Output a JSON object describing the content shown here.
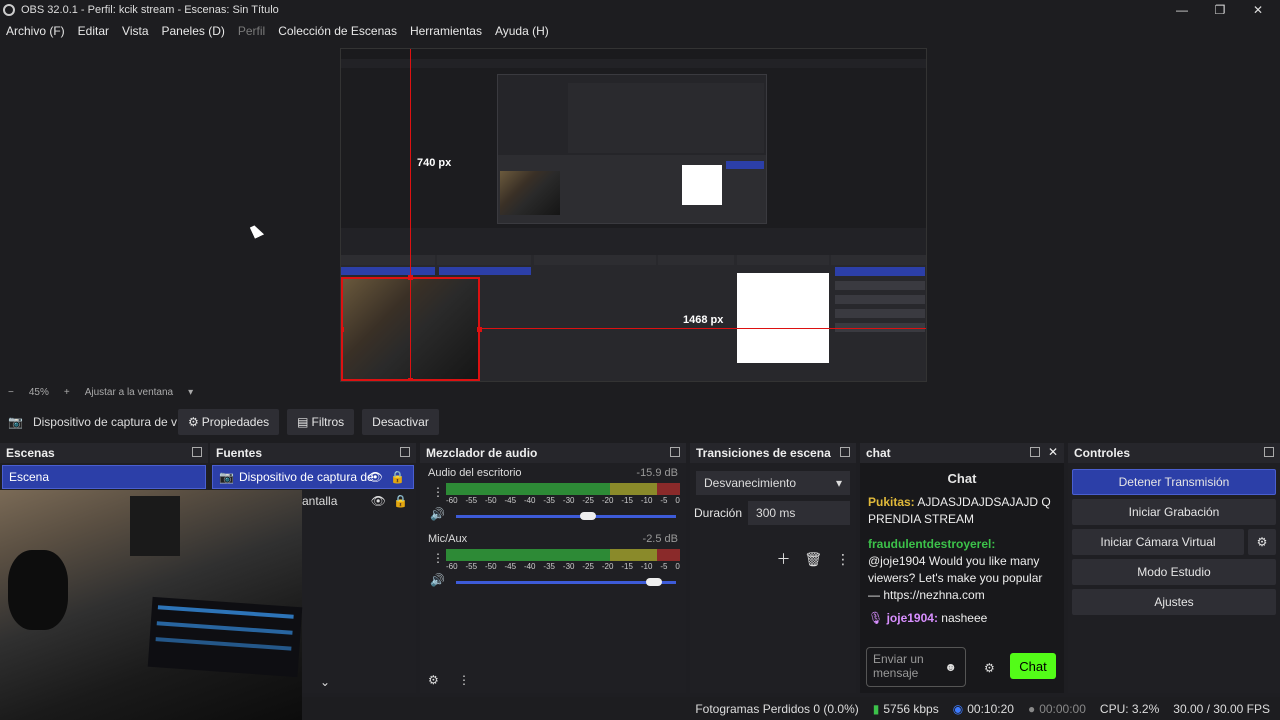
{
  "window": {
    "title": "OBS 32.0.1 - Perfil: kcik stream - Escenas: Sin Título",
    "minimize": "—",
    "maximize": "❐",
    "close": "✕"
  },
  "menu": [
    {
      "label": "Archivo (F)",
      "enabled": true
    },
    {
      "label": "Editar",
      "enabled": true
    },
    {
      "label": "Vista",
      "enabled": true
    },
    {
      "label": "Paneles (D)",
      "enabled": true
    },
    {
      "label": "Perfil",
      "enabled": false
    },
    {
      "label": "Colección de Escenas",
      "enabled": true
    },
    {
      "label": "Herramientas",
      "enabled": true
    },
    {
      "label": "Ayuda (H)",
      "enabled": true
    }
  ],
  "preview": {
    "label_vertical": "740 px",
    "label_horizontal": "1468 px"
  },
  "zoom": {
    "minus": "−",
    "value": "45%",
    "plus": "+",
    "fit": "Ajustar a la ventana"
  },
  "source_toolbar": {
    "source_name": "Dispositivo de captura de v",
    "properties": "Propiedades",
    "filters": "Filtros",
    "deactivate": "Desactivar"
  },
  "scenes": {
    "title": "Escenas",
    "items": [
      "Escena"
    ]
  },
  "sources": {
    "title": "Fuentes",
    "items": [
      "Dispositivo de captura de",
      "antalla"
    ]
  },
  "mixer": {
    "title": "Mezclador de audio",
    "scale": [
      "-60",
      "-55",
      "-50",
      "-45",
      "-40",
      "-35",
      "-30",
      "-25",
      "-20",
      "-15",
      "-10",
      "-5",
      "0"
    ],
    "channels": [
      {
        "name": "Audio del escritorio",
        "db": "-15.9 dB",
        "volume": 0.6
      },
      {
        "name": "Mic/Aux",
        "db": "-2.5 dB",
        "volume": 0.9
      }
    ]
  },
  "transitions": {
    "title": "Transiciones de escena",
    "selected": "Desvanecimiento",
    "duration_label": "Duración",
    "duration_value": "300 ms"
  },
  "chat": {
    "title": "chat",
    "header": "Chat",
    "messages": [
      {
        "user": "Pukitas:",
        "text": " AJDASJDAJDSAJAJD Q PRENDIA STREAM",
        "color": "#e0b93a"
      },
      {
        "user": "fraudulentdestroyerel:",
        "text": " @joje1904 Would you like many viewers? Let's make you popular — https://nezhna.com",
        "color": "#3cc24a"
      },
      {
        "user": "joje1904:",
        "text": " nasheee",
        "color": "#d88fff"
      }
    ],
    "input_placeholder": "Enviar un mensaje",
    "send": "Chat"
  },
  "controls": {
    "title": "Controles",
    "stop_stream": "Detener Transmisión",
    "start_recording": "Iniciar Grabación",
    "start_virtual_cam": "Iniciar Cámara Virtual",
    "studio_mode": "Modo Estudio",
    "settings": "Ajustes"
  },
  "status": {
    "dropped_frames": "Fotogramas Perdidos 0 (0.0%)",
    "bitrate": "5756 kbps",
    "stream_time": "00:10:20",
    "record_time": "00:00:00",
    "cpu": "CPU: 3.2%",
    "fps": "30.00 / 30.00 FPS"
  },
  "colors": {
    "accent": "#2c3fa8",
    "send_button": "#53fc18"
  }
}
